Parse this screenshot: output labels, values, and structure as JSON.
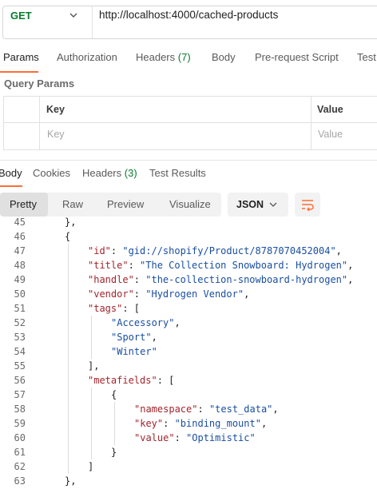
{
  "request": {
    "method": "GET",
    "url": "http://localhost:4000/cached-products"
  },
  "request_tabs": [
    {
      "label": "Params"
    },
    {
      "label": "Authorization"
    },
    {
      "label": "Headers",
      "count": "(7)"
    },
    {
      "label": "Body"
    },
    {
      "label": "Pre-request Script"
    },
    {
      "label": "Test"
    }
  ],
  "query_params": {
    "title": "Query Params",
    "columns": [
      "Key",
      "Value"
    ],
    "placeholder_key": "Key",
    "placeholder_value": "Value"
  },
  "response_tabs": [
    {
      "label": "Body"
    },
    {
      "label": "Cookies"
    },
    {
      "label": "Headers",
      "count": "(3)"
    },
    {
      "label": "Test Results"
    }
  ],
  "view_modes": [
    "Pretty",
    "Raw",
    "Preview",
    "Visualize"
  ],
  "format": "JSON",
  "code_lines": [
    {
      "n": "45",
      "i": 0,
      "t": [
        [
          "p",
          "},"
        ]
      ]
    },
    {
      "n": "46",
      "i": 0,
      "t": [
        [
          "p",
          "{"
        ]
      ]
    },
    {
      "n": "47",
      "i": 1,
      "t": [
        [
          "k",
          "\"id\""
        ],
        [
          "p",
          ": "
        ],
        [
          "s",
          "\"gid://shopify/Product/8787070452004\""
        ],
        [
          "p",
          ","
        ]
      ]
    },
    {
      "n": "48",
      "i": 1,
      "t": [
        [
          "k",
          "\"title\""
        ],
        [
          "p",
          ": "
        ],
        [
          "s",
          "\"The Collection Snowboard: Hydrogen\""
        ],
        [
          "p",
          ","
        ]
      ]
    },
    {
      "n": "49",
      "i": 1,
      "t": [
        [
          "k",
          "\"handle\""
        ],
        [
          "p",
          ": "
        ],
        [
          "s",
          "\"the-collection-snowboard-hydrogen\""
        ],
        [
          "p",
          ","
        ]
      ]
    },
    {
      "n": "50",
      "i": 1,
      "t": [
        [
          "k",
          "\"vendor\""
        ],
        [
          "p",
          ": "
        ],
        [
          "s",
          "\"Hydrogen Vendor\""
        ],
        [
          "p",
          ","
        ]
      ]
    },
    {
      "n": "51",
      "i": 1,
      "t": [
        [
          "k",
          "\"tags\""
        ],
        [
          "p",
          ": ["
        ]
      ]
    },
    {
      "n": "52",
      "i": 2,
      "t": [
        [
          "s",
          "\"Accessory\""
        ],
        [
          "p",
          ","
        ]
      ]
    },
    {
      "n": "53",
      "i": 2,
      "t": [
        [
          "s",
          "\"Sport\""
        ],
        [
          "p",
          ","
        ]
      ]
    },
    {
      "n": "54",
      "i": 2,
      "t": [
        [
          "s",
          "\"Winter\""
        ]
      ]
    },
    {
      "n": "55",
      "i": 1,
      "t": [
        [
          "p",
          "],"
        ]
      ]
    },
    {
      "n": "56",
      "i": 1,
      "t": [
        [
          "k",
          "\"metafields\""
        ],
        [
          "p",
          ": ["
        ]
      ]
    },
    {
      "n": "57",
      "i": 2,
      "t": [
        [
          "p",
          "{"
        ]
      ]
    },
    {
      "n": "58",
      "i": 3,
      "t": [
        [
          "k",
          "\"namespace\""
        ],
        [
          "p",
          ": "
        ],
        [
          "s",
          "\"test_data\""
        ],
        [
          "p",
          ","
        ]
      ]
    },
    {
      "n": "59",
      "i": 3,
      "t": [
        [
          "k",
          "\"key\""
        ],
        [
          "p",
          ": "
        ],
        [
          "s",
          "\"binding_mount\""
        ],
        [
          "p",
          ","
        ]
      ]
    },
    {
      "n": "60",
      "i": 3,
      "t": [
        [
          "k",
          "\"value\""
        ],
        [
          "p",
          ": "
        ],
        [
          "s",
          "\"Optimistic\""
        ]
      ]
    },
    {
      "n": "61",
      "i": 2,
      "t": [
        [
          "p",
          "}"
        ]
      ]
    },
    {
      "n": "62",
      "i": 1,
      "t": [
        [
          "p",
          "]"
        ]
      ]
    },
    {
      "n": "63",
      "i": 0,
      "t": [
        [
          "p",
          "},"
        ]
      ]
    }
  ],
  "colors": {
    "accent": "#ff6c37",
    "method": "#0b7a31",
    "json_key": "#a1252c",
    "json_string": "#1a4fa0"
  }
}
